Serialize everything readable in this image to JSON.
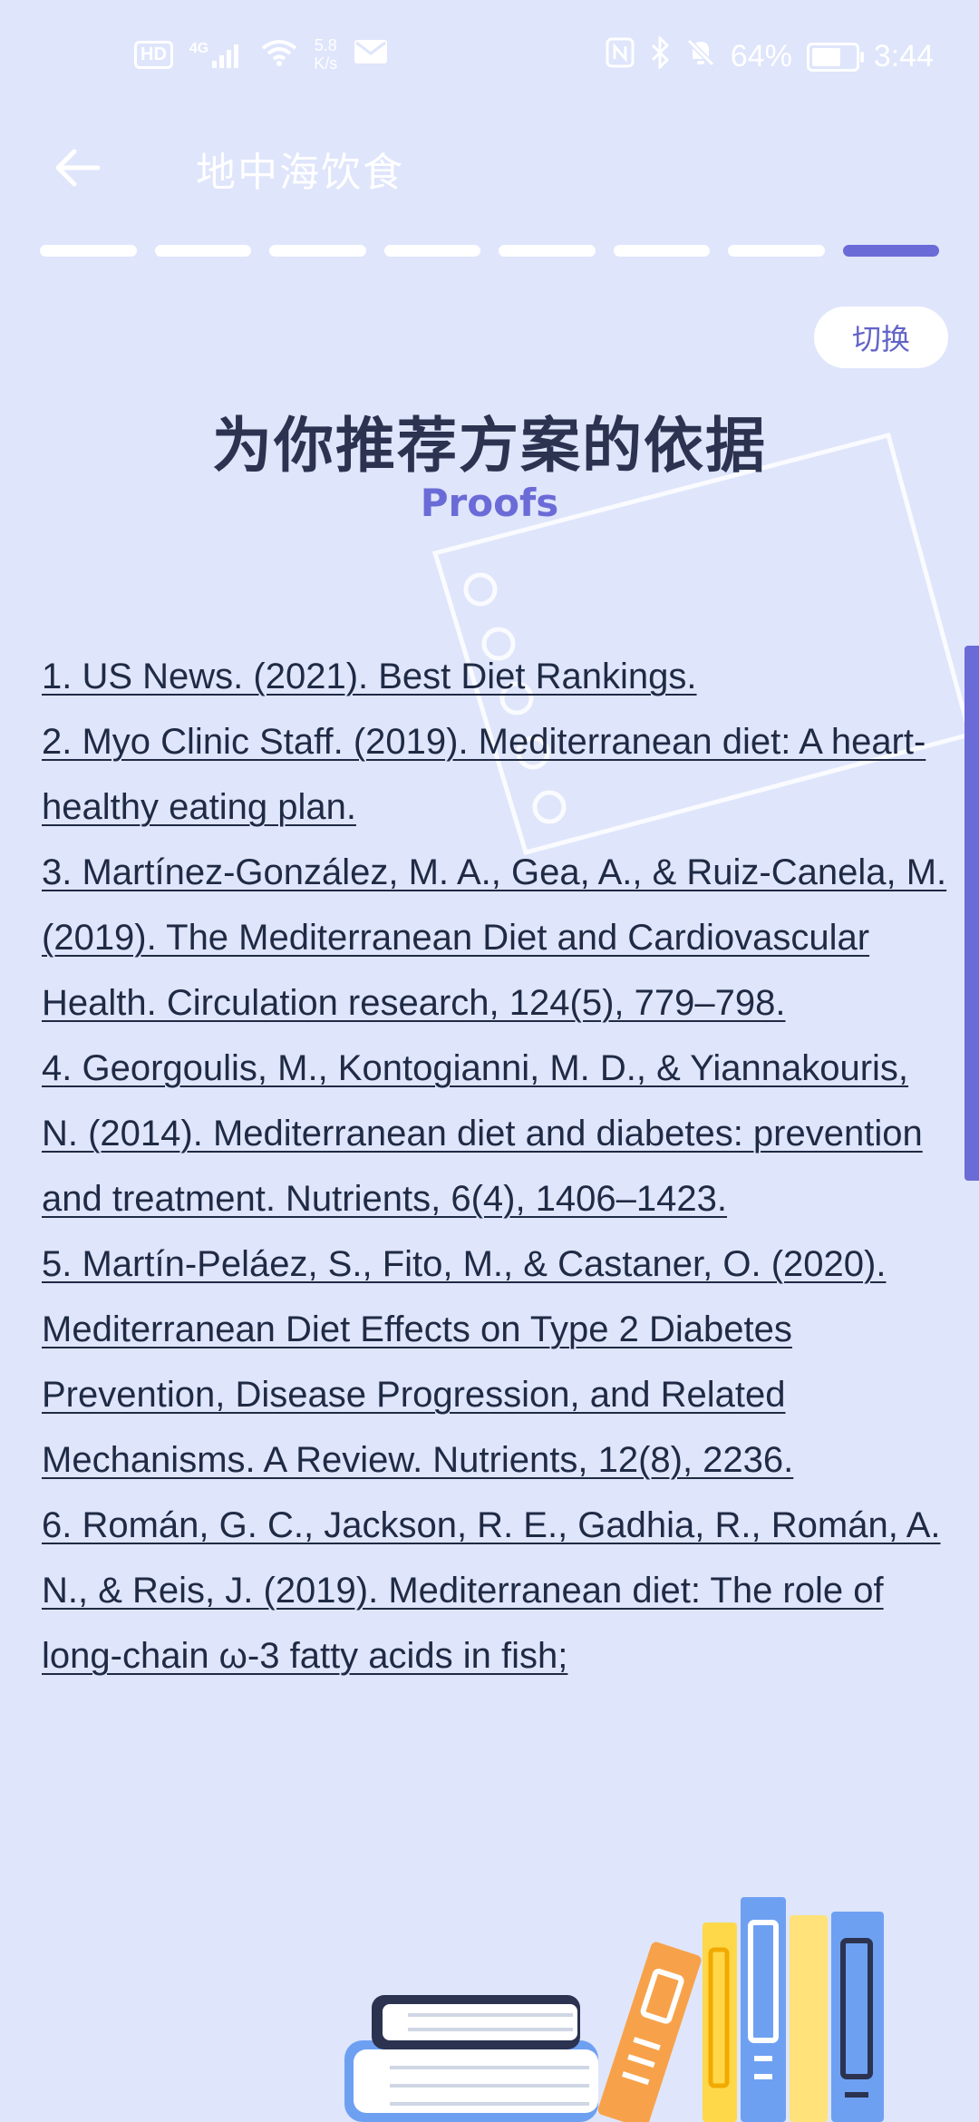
{
  "status_bar": {
    "network_label": "HD",
    "signal_label": "4G",
    "speed_value": "5.8",
    "speed_unit": "K/s",
    "battery_percent": "64%",
    "time": "3:44"
  },
  "app_bar": {
    "title": "地中海饮食"
  },
  "progress": {
    "total_steps": 8,
    "current_step": 8
  },
  "toggle_button": {
    "label": "切换"
  },
  "headline": "为你推荐方案的依据",
  "subheadline": "Proofs",
  "references": [
    "1. US News. (2021). Best Diet Rankings.",
    "2. Myo Clinic Staff. (2019). Mediterranean diet: A heart-healthy eating plan.",
    "3. Martínez-González, M. A., Gea, A., & Ruiz-Canela, M. (2019). The Mediterranean Diet and Cardiovascular Health. Circulation research, 124(5), 779–798.",
    "4. Georgoulis, M., Kontogianni, M. D., & Yiannakouris, N. (2014). Mediterranean diet and diabetes: prevention and treatment. Nutrients, 6(4), 1406–1423.",
    "5. Martín-Peláez, S., Fito, M., & Castaner, O. (2020). Mediterranean Diet Effects on Type 2 Diabetes Prevention, Disease Progression, and Related Mechanisms. A Review. Nutrients, 12(8), 2236.",
    "6. Román, G. C., Jackson, R. E., Gadhia, R., Román, A. N., & Reis, J. (2019). Mediterranean diet: The role of long-chain ω-3 fatty acids in fish;"
  ],
  "colors": {
    "background": "#dfe5fb",
    "accent": "#6b6bd7",
    "text": "#1f2a44"
  }
}
